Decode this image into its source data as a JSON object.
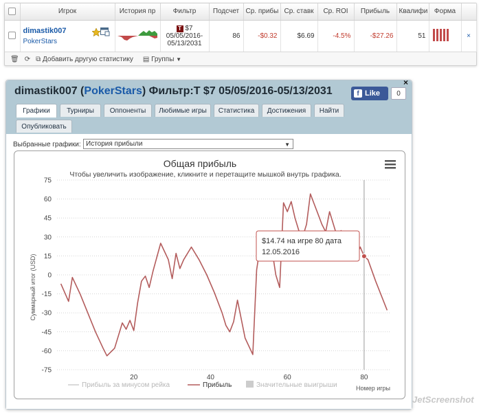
{
  "stats_table": {
    "headers": [
      "Игрок",
      "История пр",
      "Фильтр",
      "Подсчет",
      "Ср. прибы",
      "Ср. ставк",
      "Ср. ROI",
      "Прибыль",
      "Квалифи",
      "Форма"
    ],
    "row": {
      "player": "dimastik007",
      "site": "PokerStars",
      "filter_t": "T",
      "filter_value": "$7",
      "filter_dates_1": "05/05/2016-",
      "filter_dates_2": "05/13/2031",
      "count": "86",
      "avg_profit": "-$0.32",
      "avg_stake": "$6.69",
      "avg_roi": "-4.5%",
      "profit": "-$27.26",
      "qualify": "51"
    },
    "toolbar": {
      "add_stats": "Добавить другую статистику",
      "groups": "Группы"
    }
  },
  "profile": {
    "player": "dimastik007",
    "site": "PokerStars",
    "filter_text": "Фильтр:",
    "filter_value": "T $7 05/05/2016-05/13/2031",
    "like_label": "Like",
    "like_count": "0",
    "close_label": "×",
    "tabs": [
      {
        "label": "Графики",
        "active": true
      },
      {
        "label": "Турниры"
      },
      {
        "label": "Оппоненты"
      },
      {
        "label": "Любимые игры"
      },
      {
        "label": "Статистика"
      },
      {
        "label": "Достижения"
      },
      {
        "label": "Найти"
      },
      {
        "label": "Опубликовать"
      }
    ],
    "chart_select_label": "Выбранные графики:",
    "chart_select_value": "История прибыли"
  },
  "chart_data": {
    "type": "line",
    "title": "Общая прибыль",
    "subtitle": "Чтобы увеличить изображение, кликните и перетащите мышкой внутрь графика.",
    "ylabel": "Суммарный итог (USD)",
    "xlabel": "Номер игры",
    "ylim": [
      -75,
      75
    ],
    "yticks": [
      75,
      60,
      45,
      30,
      15,
      0,
      -15,
      -30,
      -45,
      -60,
      -75
    ],
    "xlim": [
      0,
      87
    ],
    "xticks": [
      20,
      40,
      60,
      80
    ],
    "grid": true,
    "legend": [
      "Прибыль за минусом рейка",
      "Прибыль",
      "Значительные выигрыши"
    ],
    "legend_position": "bottom",
    "series": [
      {
        "name": "Прибыль",
        "color": "#b35c5c",
        "x": [
          1,
          3,
          4,
          6,
          8,
          10,
          12,
          13,
          15,
          17,
          18,
          19,
          20,
          21,
          22,
          23,
          24,
          25,
          27,
          29,
          30,
          31,
          32,
          33,
          35,
          37,
          39,
          41,
          43,
          44,
          45,
          46,
          47,
          49,
          51,
          52,
          53,
          55,
          56,
          57,
          58,
          59,
          60,
          61,
          62,
          63,
          64,
          65,
          66,
          67,
          68,
          69,
          70,
          71,
          72,
          73,
          74,
          75,
          76,
          77,
          78,
          79,
          80,
          81,
          83,
          86
        ],
        "y": [
          -7,
          -21,
          -2,
          -15,
          -30,
          -45,
          -58,
          -64,
          -58,
          -38,
          -43,
          -36,
          -44,
          -22,
          -5,
          -1,
          -10,
          3,
          25,
          12,
          -3,
          17,
          5,
          12,
          22,
          12,
          0,
          -14,
          -30,
          -40,
          -45,
          -37,
          -20,
          -50,
          -63,
          4,
          24,
          12,
          20,
          0,
          -10,
          57,
          50,
          58,
          45,
          35,
          30,
          40,
          64,
          56,
          48,
          40,
          34,
          50,
          40,
          30,
          35,
          25,
          30,
          20,
          15,
          22,
          14.74,
          12,
          -5,
          -28
        ]
      }
    ],
    "tooltip": {
      "game": 80,
      "value": 14.74,
      "text_1": "$14.74 на игре 80 дата",
      "text_2": "12.05.2016"
    }
  },
  "watermark": "JetScreenshot",
  "colors": {
    "accent": "#1a5aa8",
    "negative": "#c0392b",
    "header": "#b2c9d4",
    "line": "#b35c5c"
  }
}
